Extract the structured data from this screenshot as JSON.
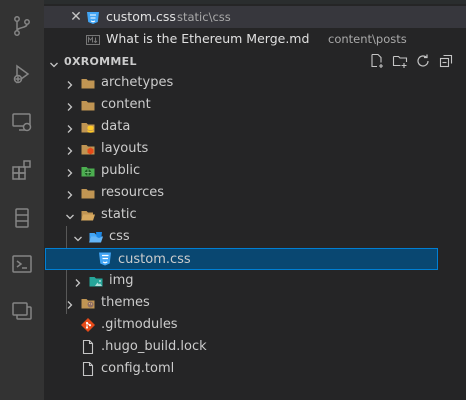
{
  "activity_bar": {
    "icons": [
      "source-control-icon",
      "run-debug-icon",
      "remote-explorer-icon",
      "extensions-icon",
      "database-icon",
      "terminal-icon",
      "layers-icon"
    ]
  },
  "open_editors": {
    "items": [
      {
        "name": "custom.css",
        "path": "static\\css",
        "active": true
      },
      {
        "name": "What is the Ethereum Merge.md",
        "path": "content\\posts",
        "active": false
      }
    ]
  },
  "explorer": {
    "title": "0XROMMEL",
    "tree": [
      {
        "label": "archetypes",
        "type": "folder",
        "expanded": false
      },
      {
        "label": "content",
        "type": "folder",
        "expanded": false
      },
      {
        "label": "data",
        "type": "folder",
        "expanded": false
      },
      {
        "label": "layouts",
        "type": "folder",
        "expanded": false
      },
      {
        "label": "public",
        "type": "folder",
        "expanded": false
      },
      {
        "label": "resources",
        "type": "folder",
        "expanded": false
      },
      {
        "label": "static",
        "type": "folder",
        "expanded": true
      },
      {
        "label": "css",
        "type": "folder",
        "expanded": true
      },
      {
        "label": "custom.css",
        "type": "file",
        "selected": true
      },
      {
        "label": "img",
        "type": "folder",
        "expanded": false
      },
      {
        "label": "themes",
        "type": "folder",
        "expanded": false
      },
      {
        "label": ".gitmodules",
        "type": "file"
      },
      {
        "label": ".hugo_build.lock",
        "type": "file"
      },
      {
        "label": "config.toml",
        "type": "file"
      }
    ]
  },
  "colors": {
    "activity_bar_bg": "#333333",
    "sidebar_bg": "#252526",
    "selection_bg": "#094771",
    "selection_border": "#007fd4",
    "css_icon": "#42a5f5",
    "folder": "#c09553"
  }
}
